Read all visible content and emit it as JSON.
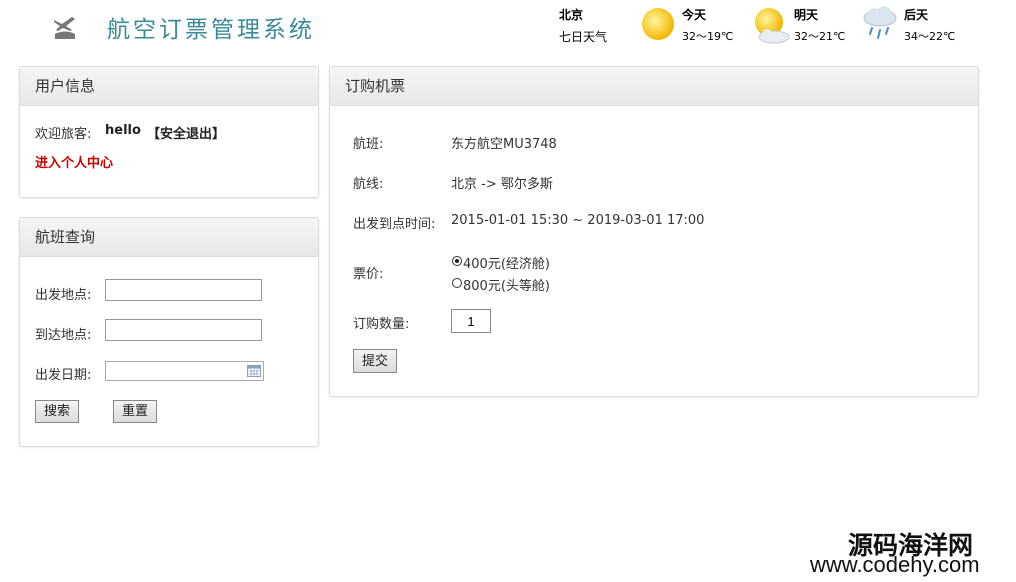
{
  "header": {
    "site_title": "航空订票管理系统",
    "logo_icon": "plane-runway-icon"
  },
  "weather": {
    "city": "北京",
    "subtitle": "七日天气",
    "days": [
      {
        "name": "今天",
        "temp": "32～19℃",
        "icon": "sunny-icon"
      },
      {
        "name": "明天",
        "temp": "32～21℃",
        "icon": "sunny-cloudy-icon"
      },
      {
        "name": "后天",
        "temp": "34～22℃",
        "icon": "rain-icon"
      }
    ]
  },
  "user_panel": {
    "title": "用户信息",
    "welcome_label": "欢迎旅客:",
    "username": "hello",
    "logout_label": "【安全退出】",
    "personal_center_label": "进入个人中心"
  },
  "search_panel": {
    "title": "航班查询",
    "departure_label": "出发地点:",
    "departure_value": "",
    "arrival_label": "到达地点:",
    "arrival_value": "",
    "date_label": "出发日期:",
    "date_value": "",
    "search_button": "搜索",
    "reset_button": "重置"
  },
  "order_panel": {
    "title": "订购机票",
    "flight_label": "航班:",
    "flight_value": "东方航空MU3748",
    "route_label": "航线:",
    "route_value": "北京 -> 鄂尔多斯",
    "time_label": "出发到点时间:",
    "time_value": "2015-01-01 15:30 ~ 2019-03-01 17:00",
    "price_label": "票价:",
    "price_options": [
      {
        "label": "400元(经济舱)",
        "selected": true
      },
      {
        "label": "800元(头等舱)",
        "selected": false
      }
    ],
    "quantity_label": "订购数量:",
    "quantity_value": "1",
    "submit_button": "提交"
  },
  "watermark": {
    "cn": "源码海洋网",
    "en": "www.codehy.com"
  }
}
